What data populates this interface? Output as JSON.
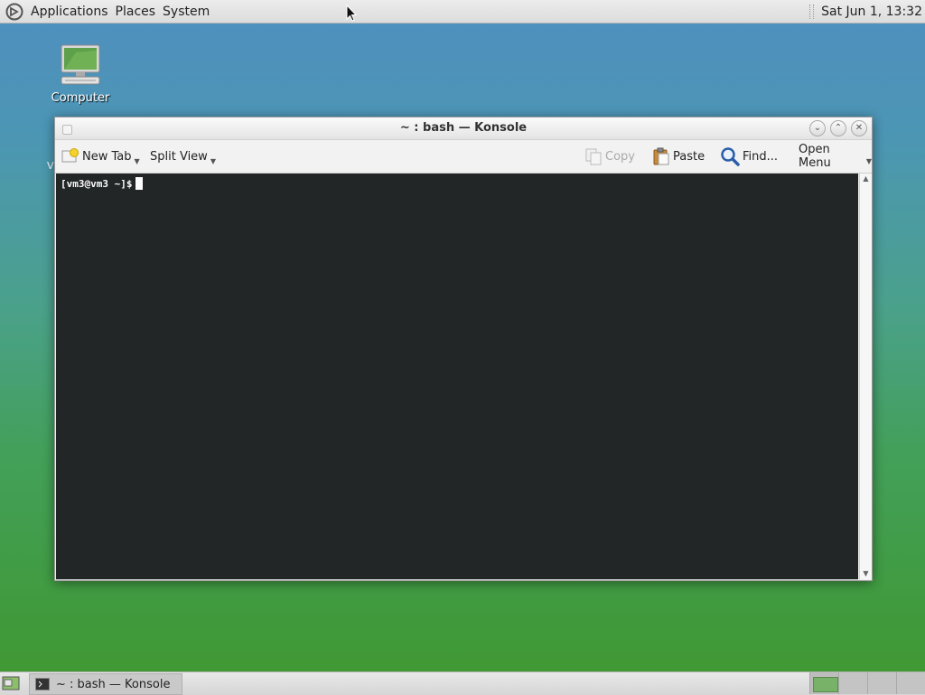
{
  "top_panel": {
    "menus": [
      "Applications",
      "Places",
      "System"
    ],
    "clock": "Sat Jun  1, 13:32"
  },
  "desktop": {
    "icons": [
      {
        "label": "Computer",
        "icon": "computer-icon"
      }
    ],
    "side_text": "V"
  },
  "window": {
    "title": "~ : bash — Konsole",
    "toolbar": {
      "new_tab": "New Tab",
      "split_view": "Split View",
      "copy": "Copy",
      "paste": "Paste",
      "find": "Find...",
      "open_menu": "Open Menu"
    },
    "terminal": {
      "prompt": "[vm3@vm3 ~]$"
    }
  },
  "taskbar": {
    "tasks": [
      {
        "label": "~ : bash — Konsole",
        "icon": "terminal-icon"
      }
    ],
    "workspaces": 4,
    "active_workspace": 1
  },
  "colors": {
    "terminal_bg": "#232627",
    "terminal_fg": "#fcfcfc",
    "panel_bg": "#e0e0e0"
  }
}
